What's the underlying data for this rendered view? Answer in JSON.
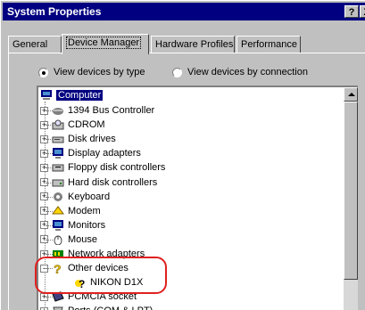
{
  "window": {
    "title": "System Properties",
    "help_button": "?",
    "close_button": "X"
  },
  "tabs": [
    {
      "label": "General",
      "active": false
    },
    {
      "label": "Device Manager",
      "active": true
    },
    {
      "label": "Hardware Profiles",
      "active": false
    },
    {
      "label": "Performance",
      "active": false
    }
  ],
  "view_options": {
    "by_type": {
      "label": "View devices by type",
      "selected": true
    },
    "by_connection": {
      "label": "View devices by connection",
      "selected": false
    }
  },
  "tree": {
    "root": "Computer",
    "items": [
      {
        "label": "1394 Bus Controller",
        "icon": "bus-controller-icon",
        "expander": "+"
      },
      {
        "label": "CDROM",
        "icon": "cdrom-icon",
        "expander": "+"
      },
      {
        "label": "Disk drives",
        "icon": "disk-drive-icon",
        "expander": "+"
      },
      {
        "label": "Display adapters",
        "icon": "display-adapter-icon",
        "expander": "+"
      },
      {
        "label": "Floppy disk controllers",
        "icon": "floppy-controller-icon",
        "expander": "+"
      },
      {
        "label": "Hard disk controllers",
        "icon": "hard-disk-controller-icon",
        "expander": "+"
      },
      {
        "label": "Keyboard",
        "icon": "keyboard-icon",
        "expander": "+"
      },
      {
        "label": "Modem",
        "icon": "modem-icon",
        "expander": "+"
      },
      {
        "label": "Monitors",
        "icon": "monitor-icon",
        "expander": "+"
      },
      {
        "label": "Mouse",
        "icon": "mouse-icon",
        "expander": "+"
      },
      {
        "label": "Network adapters",
        "icon": "network-adapter-icon",
        "expander": "+"
      },
      {
        "label": "Other devices",
        "icon": "question-mark-icon",
        "expander": "-"
      },
      {
        "label": "NIKON D1X",
        "icon": "unknown-device-icon",
        "expander": "",
        "child": true
      },
      {
        "label": "PCMCIA socket",
        "icon": "pcmcia-icon",
        "expander": "+"
      },
      {
        "label": "Ports (COM & LPT)",
        "icon": "port-icon",
        "expander": "+"
      }
    ]
  },
  "colors": {
    "highlight": "#e02020",
    "selection": "#000080"
  }
}
